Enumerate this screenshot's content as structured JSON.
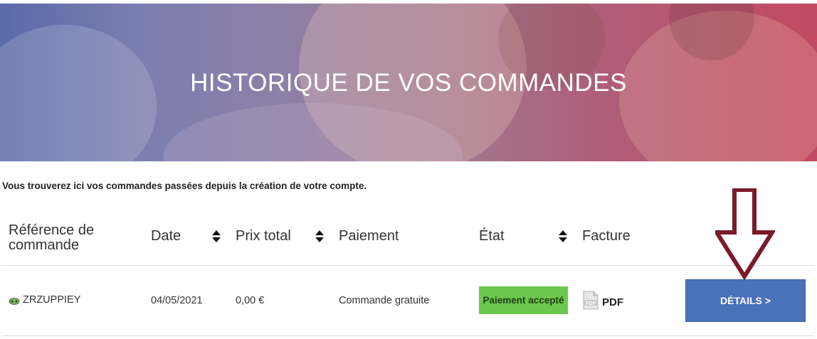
{
  "hero": {
    "title": "HISTORIQUE DE VOS COMMANDES"
  },
  "intro": "Vous trouverez ici vos commandes passées depuis la création de votre compte.",
  "table": {
    "headers": {
      "reference": "Référence de commande",
      "date": "Date",
      "total": "Prix total",
      "payment": "Paiement",
      "state": "État",
      "invoice": "Facture"
    },
    "rows": [
      {
        "reference": "ZRZUPPIEY",
        "date": "04/05/2021",
        "total": "0,00 €",
        "payment": "Commande gratuite",
        "state": "Paiement accepté",
        "invoice": "PDF",
        "details": "DÉTAILS >"
      }
    ]
  },
  "colors": {
    "state_badge": "#6cc84d",
    "details_button": "#4a72b8",
    "arrow": "#7a1a2a"
  },
  "icons": [
    "sort-icon",
    "order-reference-icon",
    "pdf-icon",
    "down-arrow-icon"
  ]
}
